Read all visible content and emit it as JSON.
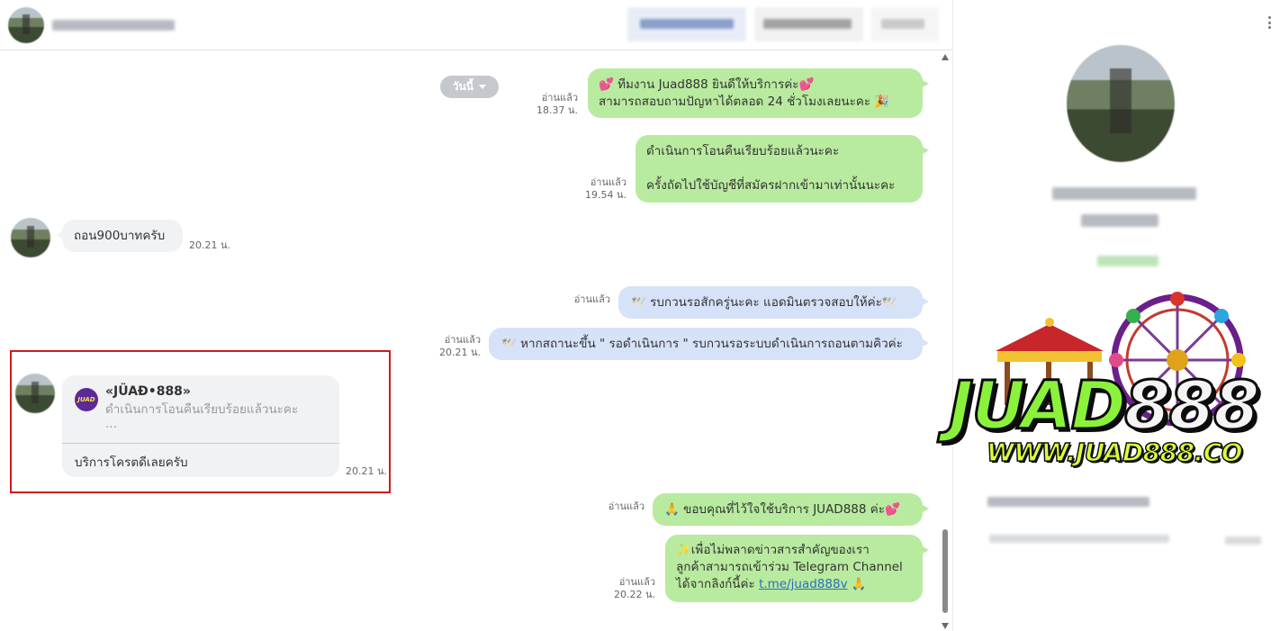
{
  "date_chip": {
    "label": "วันนี้"
  },
  "messages": {
    "m1": {
      "line1": "💕 ทีมงาน Juad888 ยินดีให้บริการค่ะ💕",
      "line2": "สามารถสอบถามปัญหาได้ตลอด 24 ชั่วโมงเลยนะคะ 🎉",
      "read": "อ่านแล้ว",
      "time": "18.37 น."
    },
    "m2": {
      "line1": "ดำเนินการโอนคืนเรียบร้อยแล้วนะคะ",
      "line2": "ครั้งถัดไปใช้บัญชีที่สมัครฝากเข้ามาเท่านั้นนะคะ",
      "read": "อ่านแล้ว",
      "time": "19.54 น."
    },
    "m3": {
      "text": "ถอน900บาทครับ",
      "time": "20.21 น."
    },
    "m4": {
      "text": "🕊️ รบกวนรอสักครู่นะคะ แอดมินตรวจสอบให้ค่ะ🕊️",
      "read": "อ่านแล้ว"
    },
    "m5": {
      "text": "🕊️ หากสถานะขึ้น \" รอดำเนินการ \" รบกวนรอระบบดำเนินการถอนตามคิวค่ะ",
      "read": "อ่านแล้ว",
      "time": "20.21 น."
    },
    "m6": {
      "quote_name": "«JÜAÐ•888»",
      "quote_badge": "JUAD",
      "quote_line1": "ดำเนินการโอนคืนเรียบร้อยแล้วนะคะ",
      "quote_line2": "...",
      "reply": "บริการโครตดีเลยครับ",
      "time": "20.21 น."
    },
    "m7": {
      "text": "🙏 ขอบคุณที่ไว้ใจใช้บริการ JUAD888 ค่ะ💕",
      "read": "อ่านแล้ว"
    },
    "m8": {
      "line1": "✨เพื่อไม่พลาดข่าวสารสำคัญของเรา",
      "line2": "ลูกค้าสามารถเข้าร่วม Telegram Channel",
      "line3_prefix": "ได้จากลิงก์นี้ค่ะ ",
      "link": "t.me/juad888v",
      "line3_suffix": " 🙏",
      "read": "อ่านแล้ว",
      "time": "20.22 น."
    }
  },
  "logo": {
    "word_juad": "JUAD",
    "word_888": "888",
    "url": "WWW.JUAD888.CO"
  },
  "colors": {
    "green_bubble": "#b8eb9f",
    "blue_bubble": "#d6e2f8",
    "grey_bubble": "#f1f2f4",
    "highlight": "#d31a1a"
  }
}
